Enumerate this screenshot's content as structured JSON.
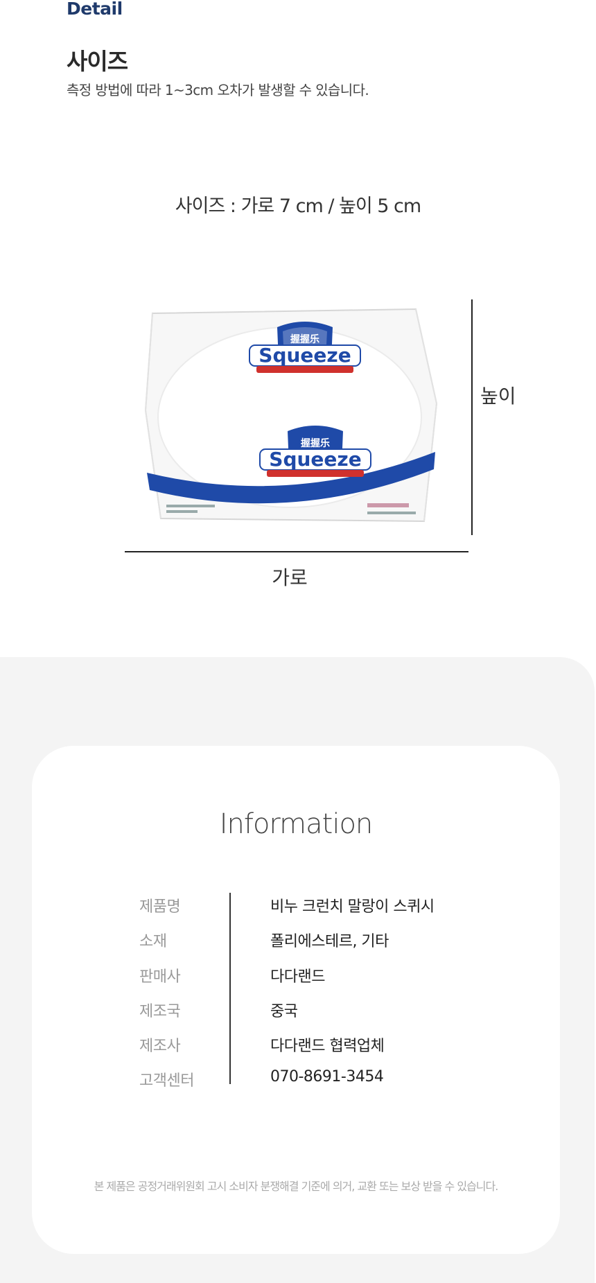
{
  "header": {
    "section_label": "Detail"
  },
  "size_section": {
    "title": "사이즈",
    "description": "측정 방법에 따라 1~3cm 오차가 발생할 수 있습니다.",
    "spec": "사이즈 : 가로 7 cm / 높이 5 cm",
    "height_label": "높이",
    "width_label": "가로",
    "product_text": {
      "brand_cn": "握握乐",
      "brand": "Squeeze"
    },
    "colors": {
      "accent_navy": "#1f3a6b",
      "shield_blue": "#1f4aa8",
      "shield_red": "#d0312d"
    }
  },
  "information": {
    "title": "Information",
    "rows": [
      {
        "label": "제품명",
        "value": "비누 크런치 말랑이 스퀴시"
      },
      {
        "label": "소재",
        "value": "폴리에스테르, 기타"
      },
      {
        "label": "판매사",
        "value": "다다랜드"
      },
      {
        "label": "제조국",
        "value": "중국"
      },
      {
        "label": "제조사",
        "value": "다다랜드 협력업체"
      },
      {
        "label": "고객센터",
        "value": "070-8691-3454"
      }
    ],
    "notice": "본 제품은 공정거래위원회 고시 소비자 분쟁해결 기준에 의거, 교환 또는 보상 받을 수 있습니다."
  }
}
